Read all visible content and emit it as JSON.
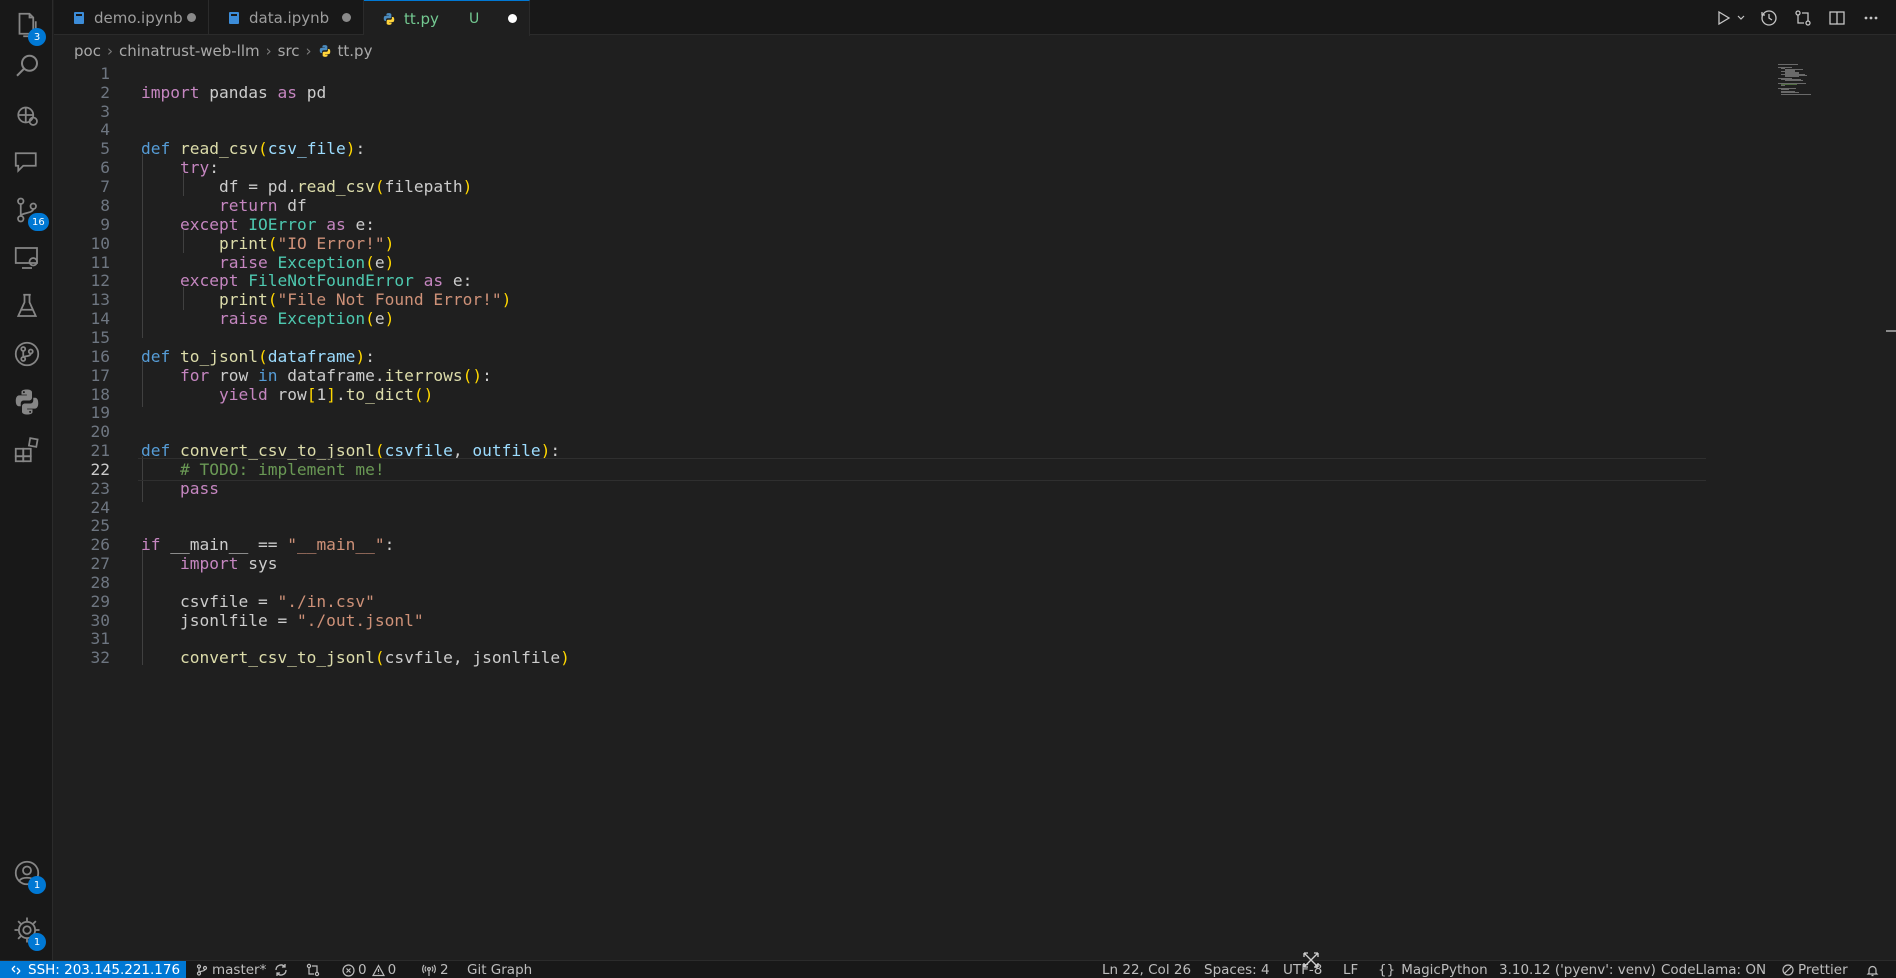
{
  "activity_bar": {
    "explorer_badge": "3",
    "scm_badge": "16",
    "accounts_badge": "1",
    "manage_badge": "1"
  },
  "tabs": [
    {
      "label": "demo.ipynb"
    },
    {
      "label": "data.ipynb"
    },
    {
      "label": "tt.py",
      "status": "U"
    }
  ],
  "breadcrumb": [
    "poc",
    "chinatrust-web-llm",
    "src",
    "tt.py"
  ],
  "editor": {
    "current_line": 22,
    "line_numbers": [
      "1",
      "2",
      "3",
      "4",
      "5",
      "6",
      "7",
      "8",
      "9",
      "10",
      "11",
      "12",
      "13",
      "14",
      "15",
      "16",
      "17",
      "18",
      "19",
      "20",
      "21",
      "22",
      "23",
      "24",
      "25",
      "26",
      "27",
      "28",
      "29",
      "30",
      "31",
      "32"
    ]
  },
  "status_bar": {
    "remote": "SSH: 203.145.221.176",
    "branch": "master*",
    "errors": "0",
    "warnings": "0",
    "ports": "2",
    "git_graph": "Git Graph",
    "cursor": "Ln 22, Col 26",
    "spaces": "Spaces: 4",
    "encoding": "UTF-8",
    "eol": "LF",
    "language": "MagicPython",
    "interpreter": "3.10.12 ('pyenv': venv)",
    "codellama": "CodeLlama: ON",
    "prettier": "Prettier"
  }
}
